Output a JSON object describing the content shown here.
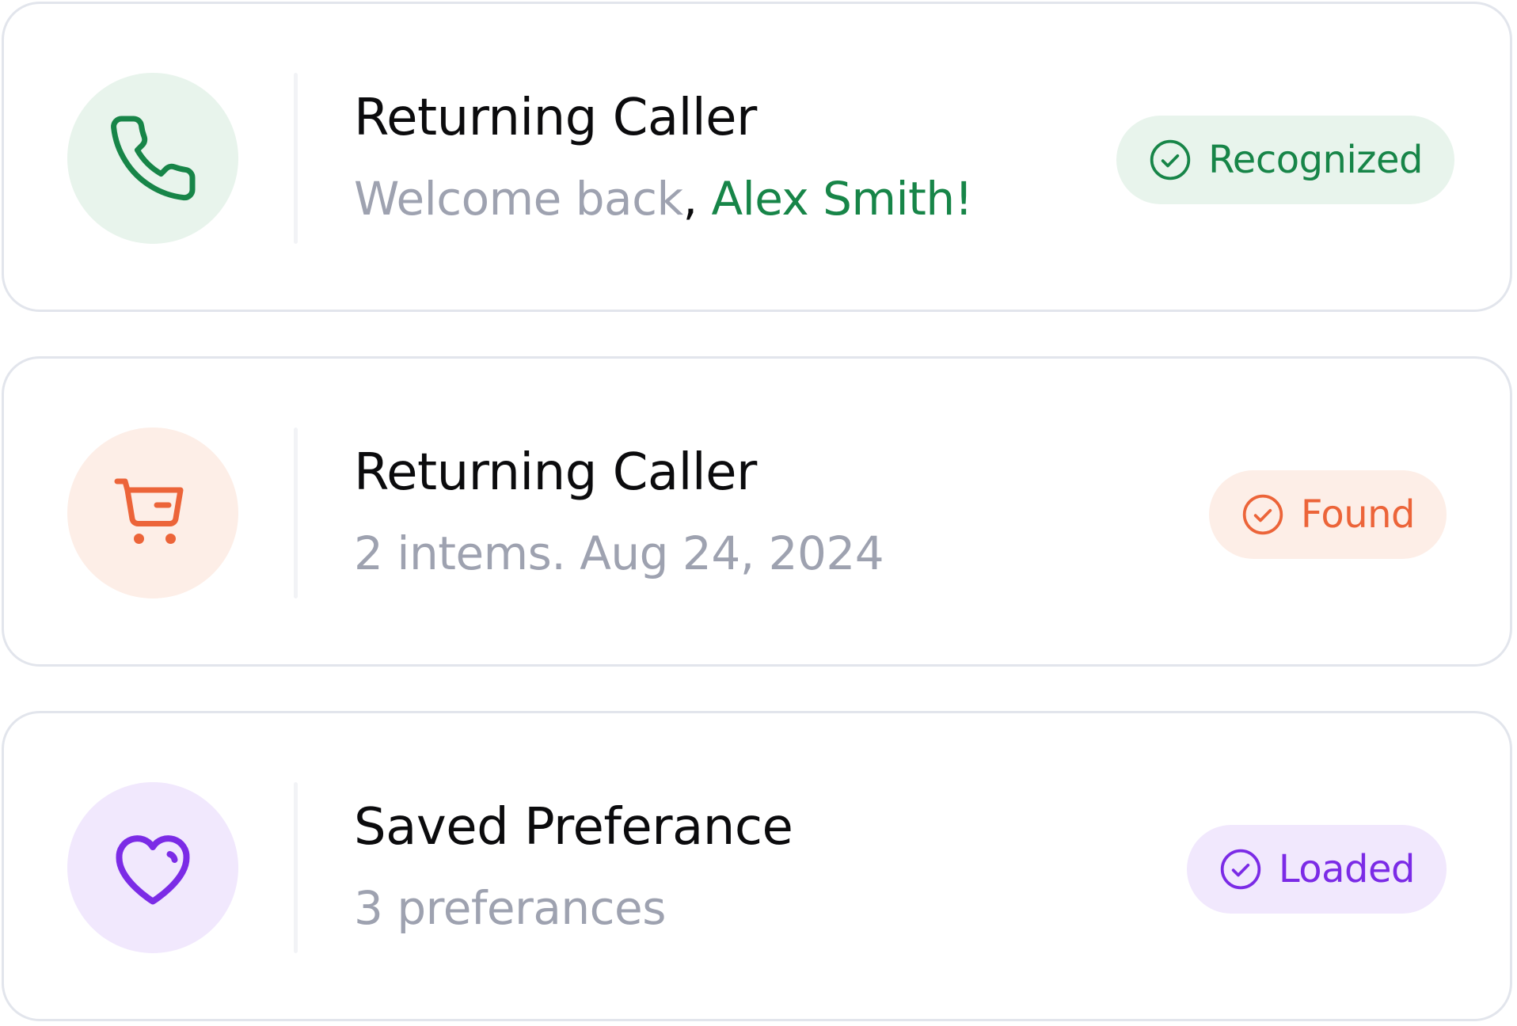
{
  "colors": {
    "green": "#178548",
    "green_bg": "#e8f4ec",
    "orange": "#ec6439",
    "orange_bg": "#fdeee7",
    "purple": "#7b2be6",
    "purple_bg": "#f1e8fd",
    "muted_text": "#9ea2b0",
    "title_text": "#0b0b0d",
    "border": "#e2e5ec"
  },
  "cards": [
    {
      "icon": "phone-icon",
      "title": "Returning Caller",
      "subtitle_prefix": "Welcome back",
      "subtitle_separator": ", ",
      "subtitle_highlight": "Alex Smith!",
      "badge": {
        "icon": "check-circle-icon",
        "label": "Recognized"
      }
    },
    {
      "icon": "cart-icon",
      "title": "Returning Caller",
      "subtitle": "2 intems. Aug 24, 2024",
      "badge": {
        "icon": "check-circle-icon",
        "label": "Found"
      }
    },
    {
      "icon": "heart-icon",
      "title": "Saved Preferance",
      "subtitle": "3 preferances",
      "badge": {
        "icon": "check-circle-icon",
        "label": "Loaded"
      }
    }
  ]
}
